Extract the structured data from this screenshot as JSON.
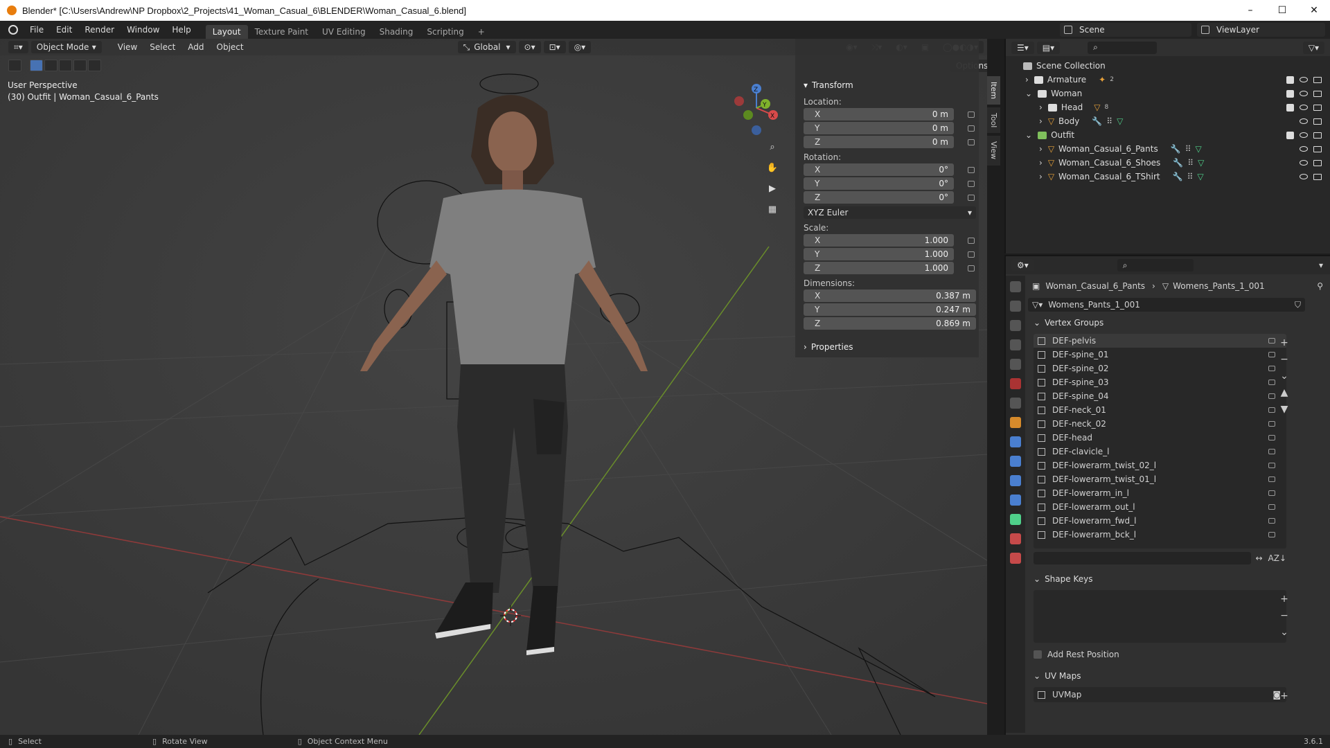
{
  "window": {
    "title": "Blender* [C:\\Users\\Andrew\\NP Dropbox\\2_Projects\\41_Woman_Casual_6\\BLENDER\\Woman_Casual_6.blend]",
    "minimize": "–",
    "maximize": "☐",
    "close": "✕"
  },
  "menu": [
    "File",
    "Edit",
    "Render",
    "Window",
    "Help"
  ],
  "workspaces": [
    "Layout",
    "Texture Paint",
    "UV Editing",
    "Shading",
    "Scripting"
  ],
  "workspace_add": "+",
  "scene": {
    "name": "Scene",
    "view_layer": "ViewLayer"
  },
  "viewport": {
    "mode": "Object Mode",
    "menus": [
      "View",
      "Select",
      "Add",
      "Object"
    ],
    "orientation": "Global",
    "options_label": "Options",
    "perspective": "User Perspective",
    "active_info": "(30) Outfit | Woman_Casual_6_Pants",
    "axis_x": "X",
    "axis_y": "Y",
    "axis_z": "Z"
  },
  "npanel": {
    "tabs": [
      "Item",
      "Tool",
      "View"
    ],
    "transform_label": "Transform",
    "location_label": "Location:",
    "location": [
      {
        "axis": "X",
        "value": "0 m"
      },
      {
        "axis": "Y",
        "value": "0 m"
      },
      {
        "axis": "Z",
        "value": "0 m"
      }
    ],
    "rotation_label": "Rotation:",
    "rotation": [
      {
        "axis": "X",
        "value": "0°"
      },
      {
        "axis": "Y",
        "value": "0°"
      },
      {
        "axis": "Z",
        "value": "0°"
      }
    ],
    "rotation_mode": "XYZ Euler",
    "scale_label": "Scale:",
    "scale": [
      {
        "axis": "X",
        "value": "1.000"
      },
      {
        "axis": "Y",
        "value": "1.000"
      },
      {
        "axis": "Z",
        "value": "1.000"
      }
    ],
    "dimensions_label": "Dimensions:",
    "dimensions": [
      {
        "axis": "X",
        "value": "0.387 m"
      },
      {
        "axis": "Y",
        "value": "0.247 m"
      },
      {
        "axis": "Z",
        "value": "0.869 m"
      }
    ],
    "properties_label": "Properties"
  },
  "outliner": {
    "root": "Scene Collection",
    "items": [
      {
        "label": "Armature",
        "badge": "2"
      },
      {
        "label": "Woman",
        "badge": ""
      },
      {
        "label": "Head",
        "badge": "8"
      },
      {
        "label": "Body",
        "badge": ""
      },
      {
        "label": "Outfit",
        "badge": ""
      },
      {
        "label": "Woman_Casual_6_Pants",
        "badge": ""
      },
      {
        "label": "Woman_Casual_6_Shoes",
        "badge": ""
      },
      {
        "label": "Woman_Casual_6_TShirt",
        "badge": ""
      }
    ]
  },
  "properties": {
    "breadcrumb_object": "Woman_Casual_6_Pants",
    "breadcrumb_mesh": "Womens_Pants_1_001",
    "mesh_name": "Womens_Pants_1_001",
    "vertex_groups_label": "Vertex Groups",
    "vertex_groups": [
      "DEF-pelvis",
      "DEF-spine_01",
      "DEF-spine_02",
      "DEF-spine_03",
      "DEF-spine_04",
      "DEF-neck_01",
      "DEF-neck_02",
      "DEF-head",
      "DEF-clavicle_l",
      "DEF-lowerarm_twist_02_l",
      "DEF-lowerarm_twist_01_l",
      "DEF-lowerarm_in_l",
      "DEF-lowerarm_out_l",
      "DEF-lowerarm_fwd_l",
      "DEF-lowerarm_bck_l"
    ],
    "shape_keys_label": "Shape Keys",
    "add_rest_position": "Add Rest Position",
    "uv_maps_label": "UV Maps",
    "uv_map": "UVMap"
  },
  "statusbar": {
    "select": "Select",
    "rotate": "Rotate View",
    "context": "Object Context Menu",
    "version": "3.6.1"
  }
}
